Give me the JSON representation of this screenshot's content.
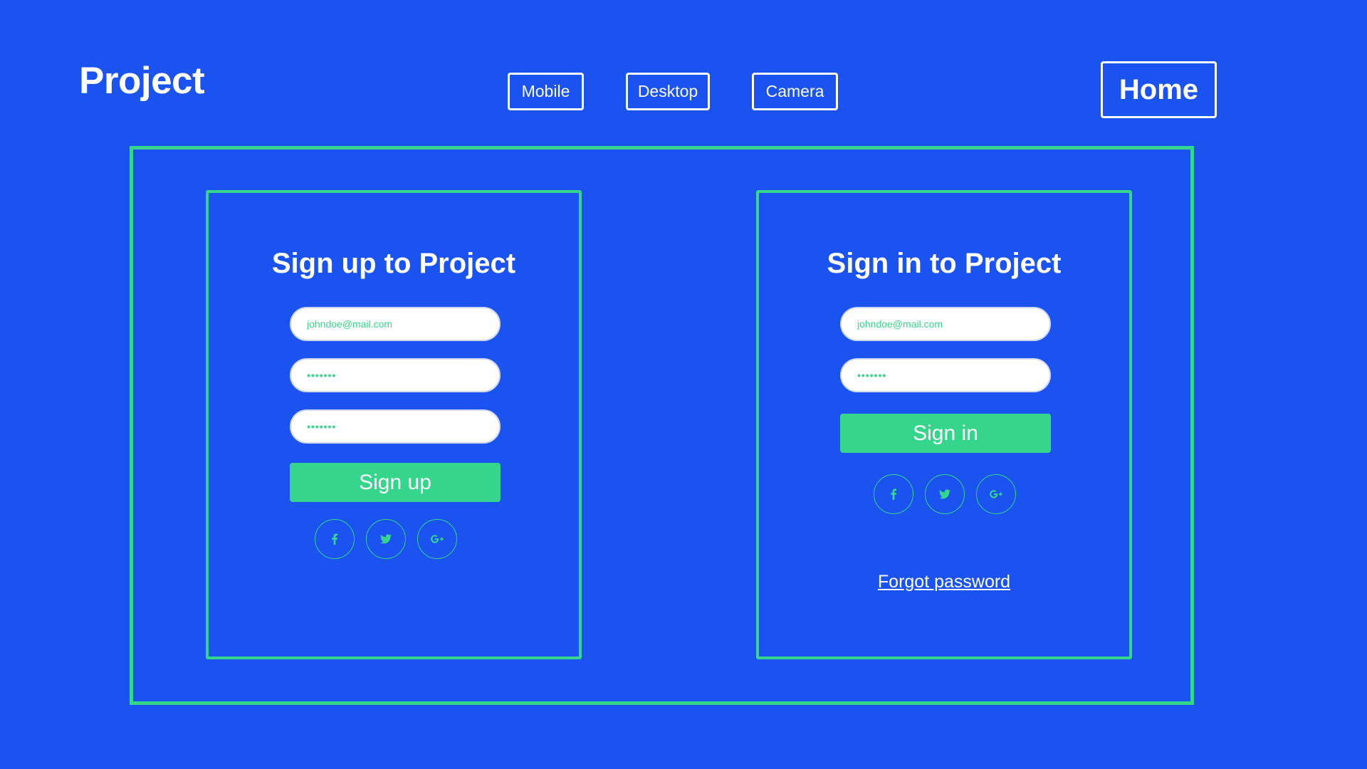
{
  "header": {
    "logo": "Project",
    "nav": [
      {
        "label": "Mobile"
      },
      {
        "label": "Desktop"
      },
      {
        "label": "Camera"
      }
    ],
    "home_label": "Home"
  },
  "signup": {
    "title": "Sign up to Project",
    "email_value": "johndoe@mail.com",
    "password_value": "•••••••",
    "confirm_value": "•••••••",
    "button_label": "Sign up",
    "social_icons": [
      "facebook-icon",
      "twitter-icon",
      "google-plus-icon"
    ]
  },
  "signin": {
    "title": "Sign in to Project",
    "email_value": "johndoe@mail.com",
    "password_value": "•••••••",
    "button_label": "Sign in",
    "social_icons": [
      "facebook-icon",
      "twitter-icon",
      "google-plus-icon"
    ],
    "forgot_label": "Forgot password"
  },
  "colors": {
    "background": "#1a53f0",
    "accent": "#35d68c",
    "text": "#ffffff"
  }
}
